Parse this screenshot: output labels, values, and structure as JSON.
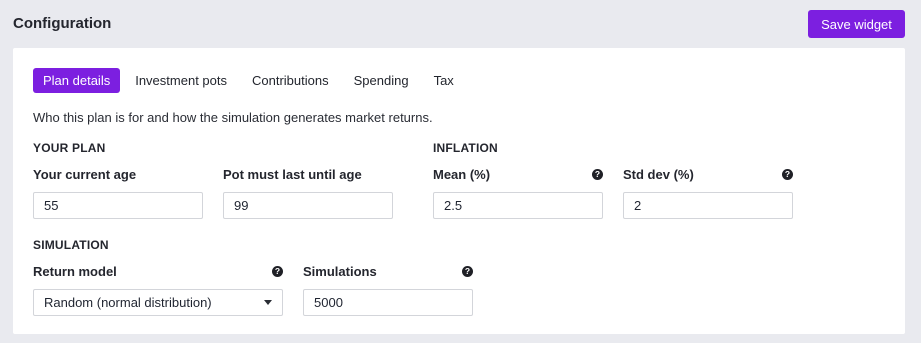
{
  "header": {
    "title": "Configuration",
    "save_label": "Save widget"
  },
  "tabs": [
    {
      "label": "Plan details",
      "active": true
    },
    {
      "label": "Investment pots",
      "active": false
    },
    {
      "label": "Contributions",
      "active": false
    },
    {
      "label": "Spending",
      "active": false
    },
    {
      "label": "Tax",
      "active": false
    }
  ],
  "intro": "Who this plan is for and how the simulation generates market returns.",
  "your_plan": {
    "heading": "YOUR PLAN",
    "current_age": {
      "label": "Your current age",
      "value": "55"
    },
    "last_until_age": {
      "label": "Pot must last until age",
      "value": "99"
    }
  },
  "inflation": {
    "heading": "INFLATION",
    "mean": {
      "label": "Mean (%)",
      "value": "2.5"
    },
    "std_dev": {
      "label": "Std dev (%)",
      "value": "2"
    }
  },
  "simulation": {
    "heading": "SIMULATION",
    "return_model": {
      "label": "Return model",
      "value": "Random (normal distribution)"
    },
    "simulations": {
      "label": "Simulations",
      "value": "5000"
    }
  },
  "help_glyph": "?",
  "colors": {
    "accent": "#7c1fe0",
    "background": "#e9eaef",
    "card": "#ffffff"
  }
}
